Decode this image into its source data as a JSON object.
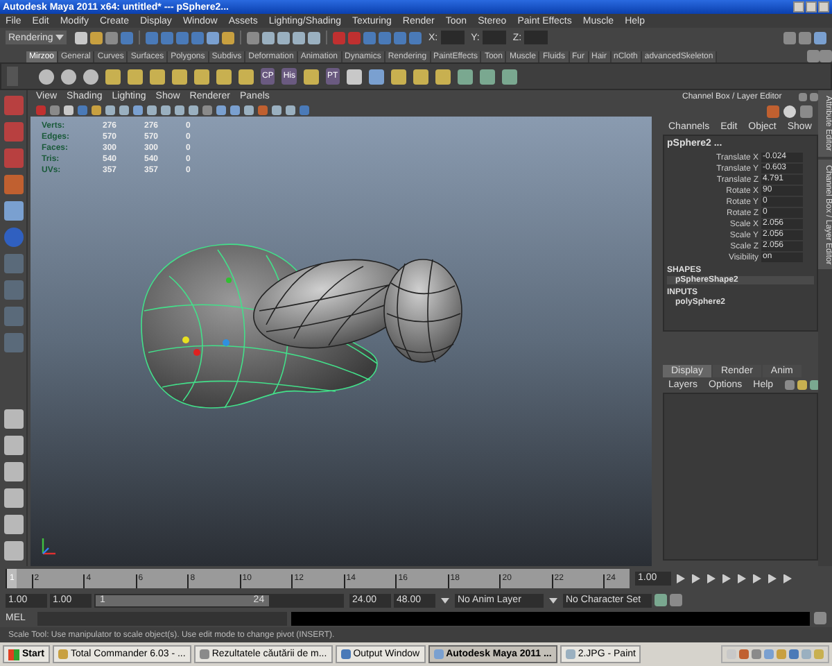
{
  "window": {
    "title": "Autodesk Maya 2011 x64: untitled*  ---  pSphere2..."
  },
  "menu_bar": [
    "File",
    "Edit",
    "Modify",
    "Create",
    "Display",
    "Window",
    "Assets",
    "Lighting/Shading",
    "Texturing",
    "Render",
    "Toon",
    "Stereo",
    "Paint Effects",
    "Muscle",
    "Help"
  ],
  "status_line": {
    "menu_set": "Rendering",
    "fields": [
      "X:",
      "Y:",
      "Z:"
    ]
  },
  "shelf": {
    "tabs": [
      {
        "label": "Mirzoo",
        "selected": true
      },
      {
        "label": "General",
        "selected": false
      },
      {
        "label": "Curves",
        "selected": false
      },
      {
        "label": "Surfaces",
        "selected": false
      },
      {
        "label": "Polygons",
        "selected": false
      },
      {
        "label": "Subdivs",
        "selected": false
      },
      {
        "label": "Deformation",
        "selected": false
      },
      {
        "label": "Animation",
        "selected": false
      },
      {
        "label": "Dynamics",
        "selected": false
      },
      {
        "label": "Rendering",
        "selected": false
      },
      {
        "label": "PaintEffects",
        "selected": false
      },
      {
        "label": "Toon",
        "selected": false
      },
      {
        "label": "Muscle",
        "selected": false
      },
      {
        "label": "Fluids",
        "selected": false
      },
      {
        "label": "Fur",
        "selected": false
      },
      {
        "label": "Hair",
        "selected": false
      },
      {
        "label": "nCloth",
        "selected": false
      },
      {
        "label": "advancedSkeleton",
        "selected": false
      }
    ],
    "tool_labels": [
      "CP",
      "His",
      "PT"
    ]
  },
  "viewport": {
    "menus": [
      "View",
      "Shading",
      "Lighting",
      "Show",
      "Renderer",
      "Panels"
    ],
    "hud": [
      {
        "label": "Verts:",
        "values": [
          "276",
          "276",
          "0"
        ]
      },
      {
        "label": "Edges:",
        "values": [
          "570",
          "570",
          "0"
        ]
      },
      {
        "label": "Faces:",
        "values": [
          "300",
          "300",
          "0"
        ]
      },
      {
        "label": "Tris:",
        "values": [
          "540",
          "540",
          "0"
        ]
      },
      {
        "label": "UVs:",
        "values": [
          "357",
          "357",
          "0"
        ]
      }
    ]
  },
  "channel_box": {
    "title": "Channel Box / Layer Editor",
    "menus": [
      "Channels",
      "Edit",
      "Object",
      "Show"
    ],
    "object": "pSphere2 ...",
    "attributes": [
      {
        "name": "Translate X",
        "value": "-0.024"
      },
      {
        "name": "Translate Y",
        "value": "-0.603"
      },
      {
        "name": "Translate Z",
        "value": "4.791"
      },
      {
        "name": "Rotate X",
        "value": "90"
      },
      {
        "name": "Rotate Y",
        "value": "0"
      },
      {
        "name": "Rotate Z",
        "value": "0"
      },
      {
        "name": "Scale X",
        "value": "2.056"
      },
      {
        "name": "Scale Y",
        "value": "2.056"
      },
      {
        "name": "Scale Z",
        "value": "2.056"
      },
      {
        "name": "Visibility",
        "value": "on"
      }
    ],
    "shapes_heading": "SHAPES",
    "shape": "pSphereShape2",
    "inputs_heading": "INPUTS",
    "input": "polySphere2"
  },
  "layer_editor": {
    "tabs": [
      {
        "label": "Display",
        "selected": true
      },
      {
        "label": "Render",
        "selected": false
      },
      {
        "label": "Anim",
        "selected": false
      }
    ],
    "menus": [
      "Layers",
      "Options",
      "Help"
    ]
  },
  "side_tabs": [
    "Attribute Editor",
    "Channel Box / Layer Editor"
  ],
  "time_slider": {
    "level": 0,
    "frame_labels": [
      "1",
      "2",
      "4",
      "6",
      "8",
      "10",
      "12",
      "14",
      "16",
      "18",
      "20",
      "22",
      "24"
    ],
    "current_time": "1.00"
  },
  "range_slider": {
    "level": 0.7,
    "start_time": "1.00",
    "playback_start": "1.00",
    "range_start": "1",
    "range_end": "24",
    "playback_end": "24.00",
    "end_time": "48.00",
    "anim_layer": "No Anim Layer",
    "character_set": "No Character Set"
  },
  "command_line": {
    "label": "MEL"
  },
  "help_line": "Scale Tool: Use manipulator to scale object(s). Use edit mode to change pivot (INSERT).",
  "taskbar": {
    "start": "Start",
    "items": [
      {
        "label": "Total Commander 6.03 - ...",
        "selected": false
      },
      {
        "label": "Rezultatele căutării de m...",
        "selected": false
      },
      {
        "label": "Output Window",
        "selected": false
      },
      {
        "label": "Autodesk Maya 2011 ...",
        "selected": true
      },
      {
        "label": "2.JPG - Paint",
        "selected": false
      }
    ]
  }
}
